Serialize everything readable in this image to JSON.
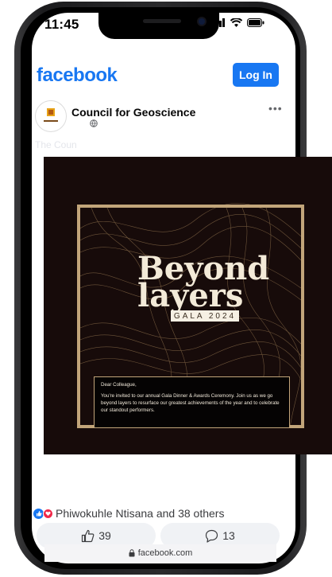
{
  "status_bar": {
    "time": "11:45"
  },
  "header": {
    "logo": "facebook",
    "login_label": "Log In"
  },
  "post": {
    "page_name": "Council for Geoscience",
    "avatar_text": "Council for Geoscience",
    "faded_text": "The Coun",
    "image": {
      "headline_line1": "Beyond",
      "headline_line2": "layers",
      "gala_label": "GALA 2024",
      "greeting": "Dear Colleague,",
      "body": "You're invited to our annual Gala Dinner & Awards Ceremony. Join us as we go beyond layers to resurface our greatest achievements of the year and to celebrate our standout performers."
    },
    "reactions_text": "Phiwokuhle Ntisana and 38 others",
    "like_count": "39",
    "comment_count": "13"
  },
  "browser": {
    "url": "facebook.com"
  },
  "colors": {
    "brand": "#1877f2",
    "poster_bg": "#170b0a",
    "gold": "#c2a57a"
  },
  "icons": [
    "signal-icon",
    "wifi-icon",
    "battery-icon",
    "globe-icon",
    "more-icon",
    "like-reaction-icon",
    "love-reaction-icon",
    "thumbs-up-icon",
    "comment-icon",
    "lock-icon"
  ]
}
